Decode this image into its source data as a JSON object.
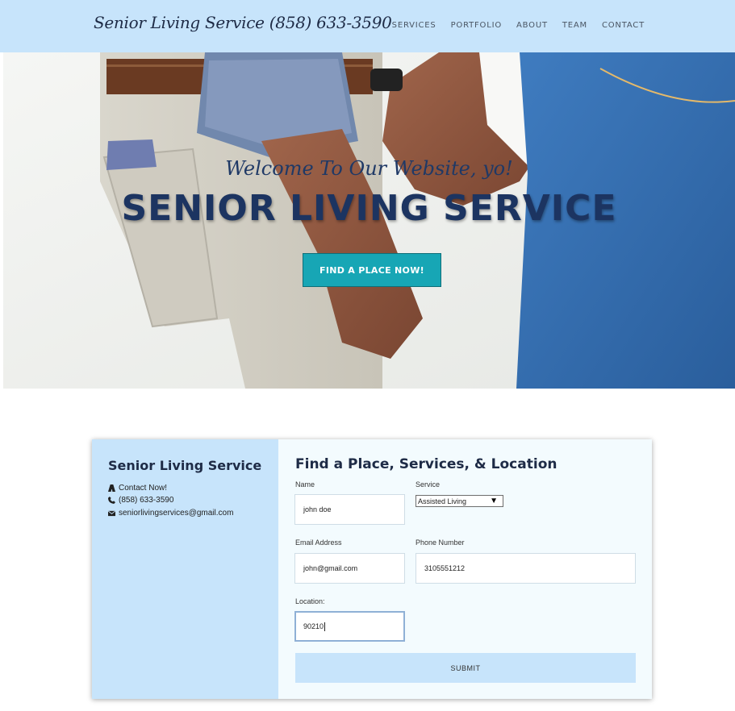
{
  "nav": {
    "brand": "Senior Living Service (858) 633-3590",
    "links": [
      "SERVICES",
      "PORTFOLIO",
      "ABOUT",
      "TEAM",
      "CONTACT"
    ]
  },
  "hero": {
    "subtitle": "Welcome To Our Website, yo!",
    "title": "SENIOR LIVING SERVICE",
    "button_label": "FIND A PLACE NOW!"
  },
  "contact_panel": {
    "title": "Senior Living Service",
    "items": [
      {
        "icon": "road-icon",
        "text": "Contact Now!"
      },
      {
        "icon": "phone-icon",
        "text": "(858) 633-3590"
      },
      {
        "icon": "envelope-icon",
        "text": "seniorlivingservices@gmail.com"
      }
    ]
  },
  "form": {
    "title": "Find a Place, Services, & Location",
    "name": {
      "label": "Name",
      "value": "john doe"
    },
    "service": {
      "label": "Service",
      "selected": "Assisted Living"
    },
    "email": {
      "label": "Email Address",
      "value": "john@gmail.com"
    },
    "phone": {
      "label": "Phone Number",
      "value": "3105551212"
    },
    "location": {
      "label": "Location:",
      "value": "90210"
    },
    "submit_label": "SUBMIT"
  },
  "colors": {
    "nav_bg": "#c7e4fb",
    "accent_button": "#17a6b5",
    "heading": "#1c3461"
  }
}
